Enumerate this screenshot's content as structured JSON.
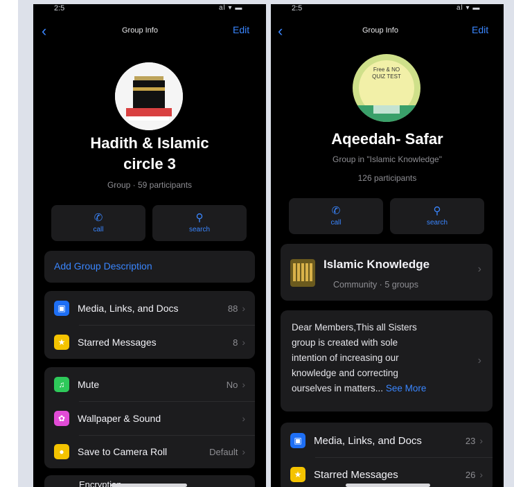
{
  "left": {
    "status": {
      "time": "2:5",
      "icons": "al ▾ ▬"
    },
    "nav": {
      "back": "‹",
      "title": "Group Info",
      "edit": "Edit"
    },
    "group": {
      "name_line1": "Hadith & Islamic",
      "name_line2": "circle 3",
      "subtitle": "Group · 59 participants"
    },
    "actions": [
      {
        "icon": "phone-icon",
        "label": "call"
      },
      {
        "icon": "search-icon",
        "label": "search"
      }
    ],
    "add_description": "Add Group Description",
    "media_section": [
      {
        "icon": "photo-icon",
        "label": "Media, Links, and Docs",
        "value": "88",
        "color": "#1e6ff5"
      },
      {
        "icon": "star-icon",
        "label": "Starred Messages",
        "value": "8",
        "color": "#f4c300"
      }
    ],
    "settings_section": [
      {
        "icon": "mute-icon",
        "label": "Mute",
        "value": "No",
        "color": "#2ec95a"
      },
      {
        "icon": "wallpaper-icon",
        "label": "Wallpaper & Sound",
        "value": "",
        "color": "#e14bd6"
      },
      {
        "icon": "camera-roll-icon",
        "label": "Save to Camera Roll",
        "value": "Default",
        "color": "#f4c300"
      }
    ],
    "partial_row": "Encryption"
  },
  "right": {
    "status": {
      "time": "2:5",
      "icons": "al ▾ ▬"
    },
    "nav": {
      "back": "‹",
      "title": "Group Info",
      "edit": "Edit"
    },
    "group": {
      "name": "Aqeedah- Safar",
      "subtitle_line1": "Group in \"Islamic Knowledge\"",
      "subtitle_line2": "126 participants"
    },
    "avatar_text": "Free & NO QUIZ TEST",
    "actions": [
      {
        "icon": "phone-icon",
        "label": "call"
      },
      {
        "icon": "search-icon",
        "label": "search"
      }
    ],
    "community": {
      "name": "Islamic Knowledge",
      "sub": "Community · 5 groups"
    },
    "description": {
      "lines": [
        "Dear Members,This all Sisters",
        "group is created with sole",
        "intention of increasing our",
        "knowledge and correcting",
        "ourselves in matters..."
      ],
      "see_more": "See More"
    },
    "media_section": [
      {
        "icon": "photo-icon",
        "label": "Media, Links, and Docs",
        "value": "23",
        "color": "#1e6ff5"
      },
      {
        "icon": "star-icon",
        "label": "Starred Messages",
        "value": "26",
        "color": "#f4c300"
      }
    ]
  },
  "colors": {
    "accent": "#3a86ff",
    "background": "#000000",
    "card": "#1c1c1e",
    "frame": "#dde1ea"
  }
}
